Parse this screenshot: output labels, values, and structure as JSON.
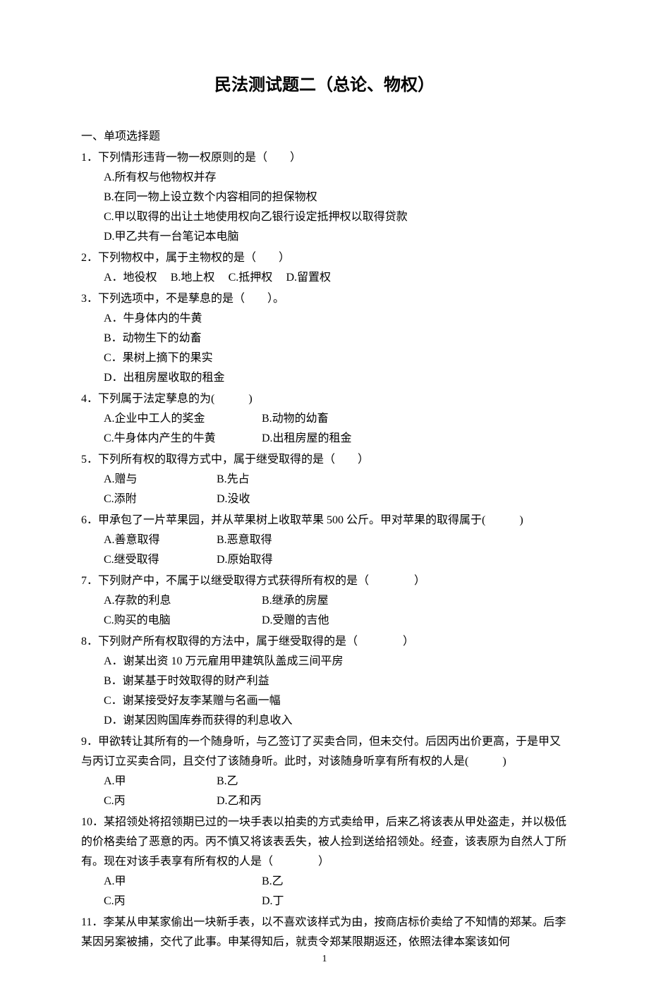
{
  "title": "民法测试题二（总论、物权）",
  "section_heading": "一、单项选择题",
  "page_number": "1",
  "questions": [
    {
      "stem": "1．下列情形违背一物一权原则的是（　　）",
      "layout": "stack",
      "opts": [
        "A.所有权与他物权并存",
        "B.在同一物上设立数个内容相同的担保物权",
        "C.甲以取得的出让土地使用权向乙银行设定抵押权以取得贷款",
        "D.甲乙共有一台笔记本电脑"
      ]
    },
    {
      "stem": "2．下列物权中，属于主物权的是（　　）",
      "layout": "inline",
      "opts": [
        "A．地役权",
        "B.地上权",
        "C.抵押权",
        "D.留置权"
      ]
    },
    {
      "stem": "3．下列选项中，不是孳息的是（　　）。",
      "layout": "stack",
      "opts": [
        "A．牛身体内的牛黄",
        "B．动物生下的幼畜",
        "C．果树上摘下的果实",
        "D．出租房屋收取的租金"
      ]
    },
    {
      "stem": "4．下列属于法定孳息的为(　　　)",
      "layout": "two-col",
      "opts": [
        "A.企业中工人的奖金",
        "B.动物的幼畜",
        "C.牛身体内产生的牛黄",
        "D.出租房屋的租金"
      ]
    },
    {
      "stem": "5．下列所有权的取得方式中，属于继受取得的是（　　）",
      "layout": "two-col-narrow",
      "opts": [
        "A.赠与",
        "B.先占",
        "C.添附",
        "D.没收"
      ]
    },
    {
      "stem": "6．甲承包了一片苹果园，并从苹果树上收取苹果 500 公斤。甲对苹果的取得属于(　　　)",
      "layout": "two-col-narrow",
      "opts": [
        "A.善意取得",
        "B.恶意取得",
        "C.继受取得",
        "D.原始取得"
      ]
    },
    {
      "stem": "7．下列财产中，不属于以继受取得方式获得所有权的是（　　　　）",
      "layout": "two-col",
      "opts": [
        "A.存款的利息",
        "B.继承的房屋",
        "C.购买的电脑",
        "D.受赠的吉他"
      ]
    },
    {
      "stem": "8．下列财产所有权取得的方法中，属于继受取得的是（　　　　）",
      "layout": "stack",
      "opts": [
        "A．谢某出资 10 万元雇用甲建筑队盖成三间平房",
        "B．谢某基于时效取得的财产利益",
        "C．谢某接受好友李某赠与名画一幅",
        "D．谢某因购国库券而获得的利息收入"
      ]
    },
    {
      "stem": "9．甲欲转让其所有的一个随身听，与乙签订了买卖合同，但未交付。后因丙出价更高，于是甲又与丙订立买卖合同，且交付了该随身听。此时，对该随身听享有所有权的人是(　　　)",
      "layout": "two-col-narrow",
      "opts": [
        "A.甲",
        "B.乙",
        "C.丙",
        "D.乙和丙"
      ]
    },
    {
      "stem": "10．某招领处将招领期已过的一块手表以拍卖的方式卖给甲，后来乙将该表从甲处盗走，并以极低的价格卖给了恶意的丙。丙不慎又将该表丢失，被人捡到送给招领处。经查，该表原为自然人丁所有。现在对该手表享有所有权的人是（　　　　）",
      "layout": "two-col",
      "opts": [
        "A.甲",
        "B.乙",
        "C.丙",
        "D.丁"
      ]
    },
    {
      "stem": "11．李某从申某家偷出一块新手表，以不喜欢该样式为由，按商店标价卖给了不知情的郑某。后李某因另案被捕，交代了此事。申某得知后，就责令郑某限期返还，依照法律本案该如何",
      "layout": "none",
      "opts": []
    }
  ]
}
